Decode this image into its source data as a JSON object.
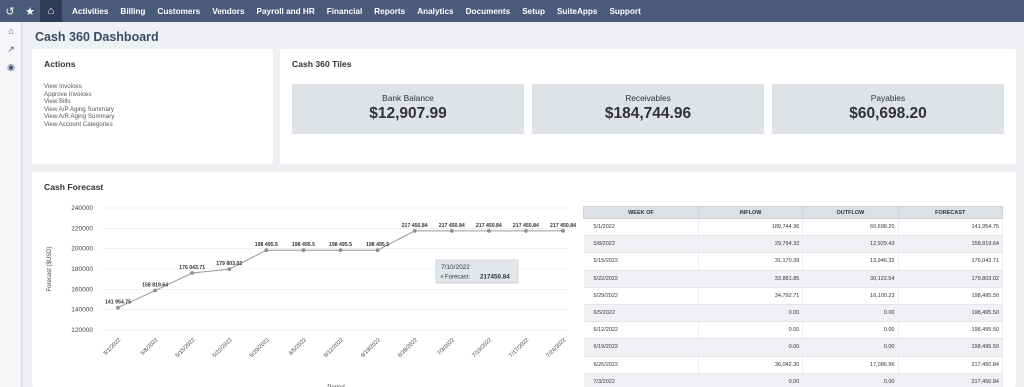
{
  "nav": {
    "items": [
      "Activities",
      "Billing",
      "Customers",
      "Vendors",
      "Payroll and HR",
      "Financial",
      "Reports",
      "Analytics",
      "Documents",
      "Setup",
      "SuiteApps",
      "Support"
    ]
  },
  "page": {
    "title": "Cash 360 Dashboard"
  },
  "actions": {
    "title": "Actions",
    "links": [
      "View Invoices",
      "Approve Invoices",
      "View Bills",
      "View A/P Aging Summary",
      "View A/R Aging Summary",
      "View Account Categories"
    ]
  },
  "tiles": {
    "title": "Cash 360 Tiles",
    "items": [
      {
        "label": "Bank Balance",
        "value": "$12,907.99"
      },
      {
        "label": "Receivables",
        "value": "$184,744.96"
      },
      {
        "label": "Payables",
        "value": "$60,698.20"
      }
    ]
  },
  "forecast": {
    "title": "Cash Forecast",
    "tooltip": {
      "date": "7/10/2022",
      "label": "Forecast:",
      "value": "217450.84"
    }
  },
  "table": {
    "headers": [
      "WEEK OF",
      "INFLOW",
      "OUTFLOW",
      "FORECAST"
    ],
    "rows": [
      [
        "5/1/2022",
        "189,744.96",
        "60,698.20",
        "141,954.75"
      ],
      [
        "5/8/2022",
        "29,794.32",
        "12,929.43",
        "158,819.64"
      ],
      [
        "5/15/2022",
        "31,170.39",
        "13,946.32",
        "176,043.71"
      ],
      [
        "5/22/2022",
        "33,881.85",
        "30,122.54",
        "179,803.02"
      ],
      [
        "5/29/2022",
        "34,792.71",
        "16,100.23",
        "198,495.50"
      ],
      [
        "6/5/2022",
        "0.00",
        "0.00",
        "198,495.50"
      ],
      [
        "6/12/2022",
        "0.00",
        "0.00",
        "198,495.50"
      ],
      [
        "6/19/2022",
        "0.00",
        "0.00",
        "198,495.50"
      ],
      [
        "6/26/2022",
        "36,042.30",
        "17,086.96",
        "217,450.84"
      ],
      [
        "7/3/2022",
        "0.00",
        "0.00",
        "217,450.84"
      ]
    ]
  },
  "chart_data": {
    "type": "line",
    "xlabel": "Period",
    "ylabel": "Forecast ($USD)",
    "ylim": [
      120000,
      240000
    ],
    "yticks": [
      120000,
      140000,
      160000,
      180000,
      200000,
      220000,
      240000
    ],
    "categories": [
      "5/1/2022",
      "5/8/2022",
      "5/15/2022",
      "5/22/2022",
      "5/29/2022",
      "6/5/2022",
      "6/12/2022",
      "6/19/2022",
      "6/28/2022",
      "7/3/2022",
      "7/10/2022",
      "7/17/2022",
      "7/24/2022"
    ],
    "values": [
      141954.75,
      158819.64,
      176043.71,
      179803.02,
      198495.5,
      198495.5,
      198495.5,
      198495.5,
      217450.84,
      217450.84,
      217450.84,
      217450.84,
      217450.84
    ],
    "data_labels": [
      "141 954.75",
      "158 819.64",
      "176 043.71",
      "179 803.02",
      "198 495.5",
      "198 495.5",
      "198 495.5",
      "198 495.5",
      "217 450.84",
      "217 450.84",
      "217 450.84",
      "217 450.84",
      "217 450.84"
    ],
    "grid": true,
    "line_color": "#999999",
    "point_color": "#8a8f98"
  }
}
